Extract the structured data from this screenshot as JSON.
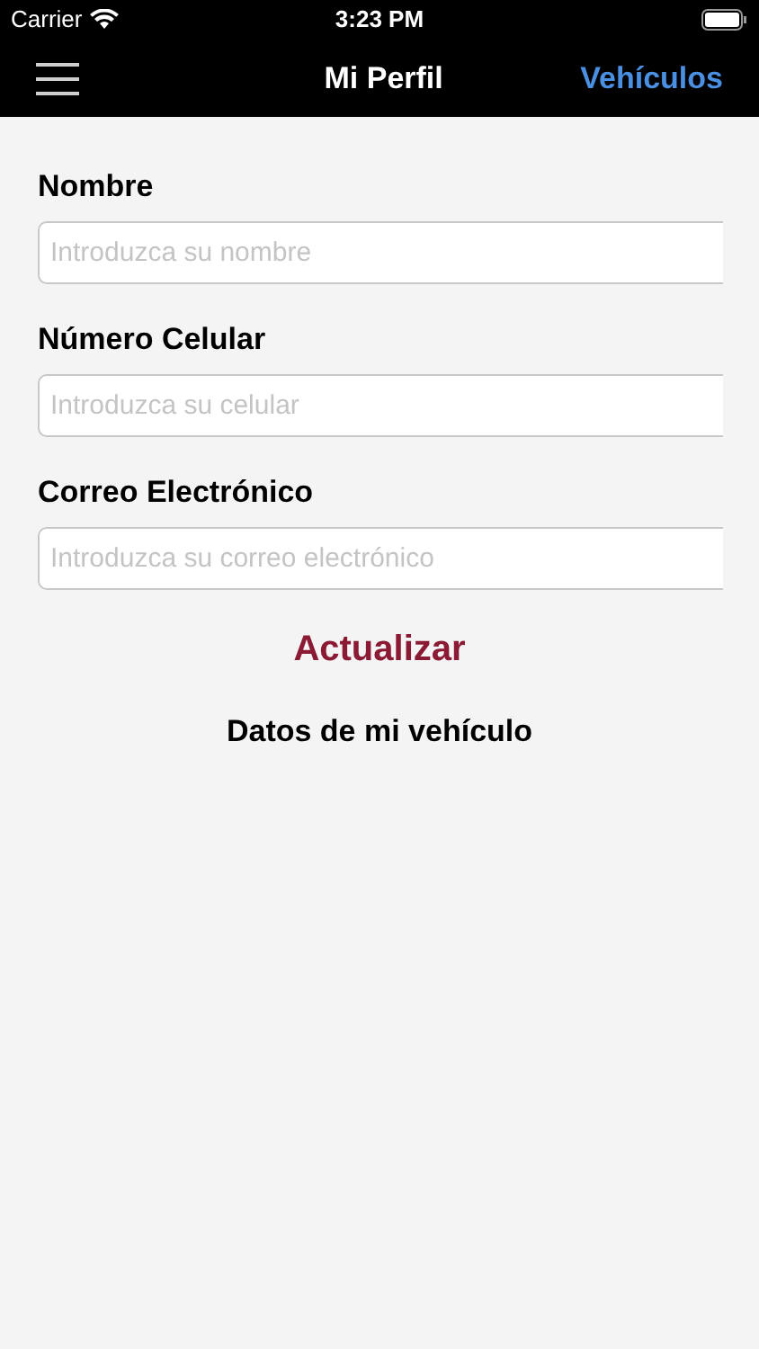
{
  "status_bar": {
    "carrier": "Carrier",
    "time": "3:23 PM"
  },
  "nav_bar": {
    "title": "Mi Perfil",
    "right_button": "Vehículos"
  },
  "fields": [
    {
      "label": "Nombre",
      "placeholder": "Introduzca su nombre"
    },
    {
      "label": "Número Celular",
      "placeholder": "Introduzca su celular"
    },
    {
      "label": "Correo Electrónico",
      "placeholder": "Introduzca su correo electrónico"
    }
  ],
  "update_button": "Actualizar",
  "section_title": "Datos de mi vehículo"
}
